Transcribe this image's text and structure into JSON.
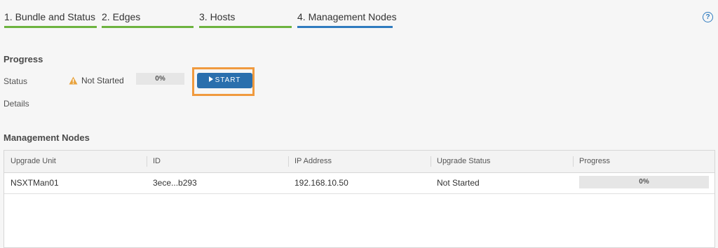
{
  "steps": [
    {
      "label": "1. Bundle and Status",
      "color": "#6db33f"
    },
    {
      "label": "2. Edges",
      "color": "#6db33f"
    },
    {
      "label": "3. Hosts",
      "color": "#6db33f"
    },
    {
      "label": "4. Management Nodes",
      "color": "#2f7bbf"
    }
  ],
  "help_icon": "?",
  "progress": {
    "title": "Progress",
    "status_label": "Status",
    "status_icon": "warning-icon",
    "status_text": "Not Started",
    "percent_text": "0%",
    "percent_value": 0,
    "start_label": "START",
    "details_label": "Details"
  },
  "management_nodes": {
    "title": "Management Nodes",
    "columns": [
      "Upgrade Unit",
      "ID",
      "IP Address",
      "Upgrade Status",
      "Progress"
    ],
    "rows": [
      {
        "unit": "NSXTMan01",
        "id": "3ece...b293",
        "ip": "192.168.10.50",
        "status": "Not Started",
        "progress_text": "0%",
        "progress_value": 0
      }
    ]
  },
  "colors": {
    "accent": "#2a6fad",
    "complete": "#6db33f",
    "warning": "#e8a33d",
    "highlight": "#f09a3e"
  }
}
